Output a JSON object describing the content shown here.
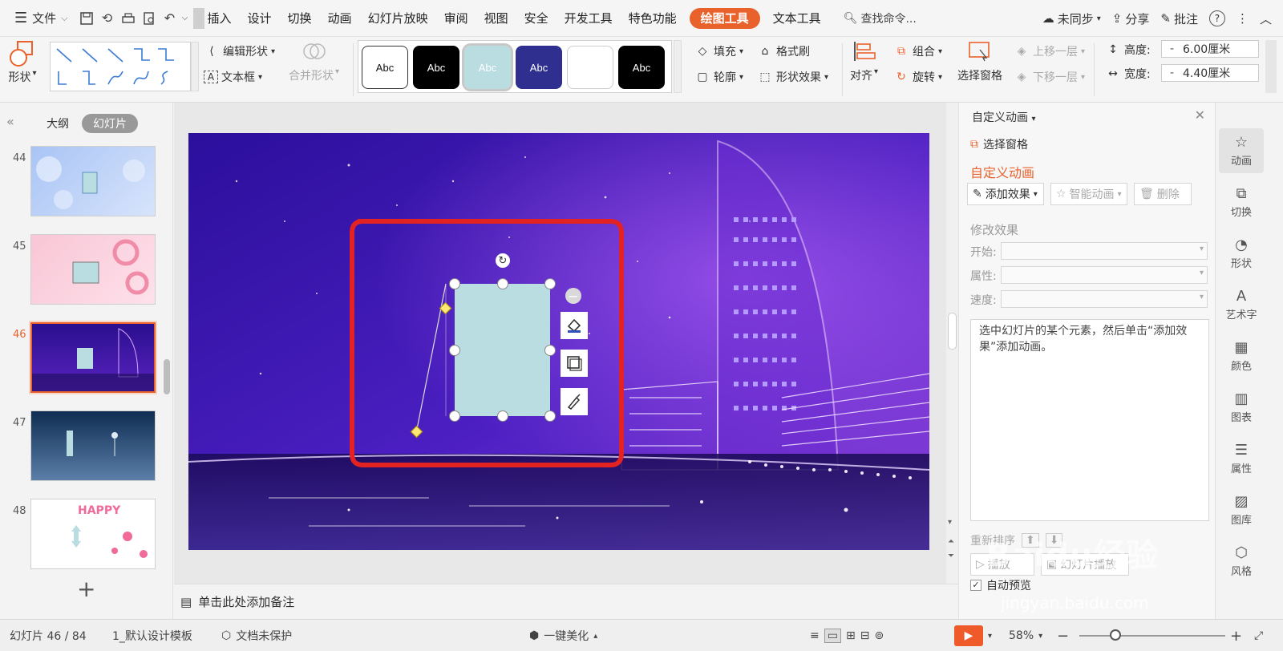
{
  "menubar": {
    "file_label": "文件",
    "tabs": [
      "插入",
      "设计",
      "切换",
      "动画",
      "幻灯片放映",
      "审阅",
      "视图",
      "安全",
      "开发工具",
      "特色功能",
      "绘图工具",
      "文本工具"
    ],
    "active_tab": "绘图工具",
    "search_label": "查找命令...",
    "sync_label": "未同步",
    "share_label": "分享",
    "comment_label": "批注",
    "help_icon": "?"
  },
  "ribbon": {
    "shape_label": "形状",
    "edit_shape_label": "编辑形状",
    "textbox_label": "文本框",
    "merge_shape_label": "合并形状",
    "style_swatches": [
      "Abc",
      "Abc",
      "Abc",
      "Abc",
      "",
      "Abc"
    ],
    "fill_label": "填充",
    "format_painter_label": "格式刷",
    "outline_label": "轮廓",
    "shape_effect_label": "形状效果",
    "align_label": "对齐",
    "group_label": "组合",
    "rotate_label": "旋转",
    "select_pane_label": "选择窗格",
    "bring_forward_label": "上移一层",
    "send_backward_label": "下移一层",
    "height_label": "高度:",
    "height_value": "6.00厘米",
    "width_label": "宽度:",
    "width_value": "4.40厘米",
    "minus": "-"
  },
  "leftpanel": {
    "tab_outline": "大纲",
    "tab_slides": "幻灯片",
    "slides": [
      {
        "num": "44"
      },
      {
        "num": "45"
      },
      {
        "num": "46"
      },
      {
        "num": "47"
      },
      {
        "num": "48",
        "text": "HAPPY"
      }
    ],
    "add_symbol": "+"
  },
  "notes": {
    "placeholder": "单击此处添加备注"
  },
  "taskpane": {
    "title": "自定义动画",
    "select_pane": "选择窗格",
    "heading": "自定义动画",
    "add_effect": "添加效果",
    "smart_anim": "智能动画",
    "delete": "删除",
    "modify_heading": "修改效果",
    "start_label": "开始:",
    "property_label": "属性:",
    "speed_label": "速度:",
    "hint": "选中幻灯片的某个元素，然后单击“添加效果”添加动画。",
    "reorder_label": "重新排序",
    "play_label": "播放",
    "show_label": "幻灯片播放",
    "auto_preview": "自动预览"
  },
  "sidebar": {
    "items": [
      "动画",
      "切换",
      "形状",
      "艺术字",
      "颜色",
      "图表",
      "属性",
      "图库",
      "风格"
    ]
  },
  "statusbar": {
    "slide_info": "幻灯片 46 / 84",
    "template": "1_默认设计模板",
    "protect": "文档未保护",
    "beautify": "一键美化",
    "zoom": "58%"
  },
  "watermark": {
    "text": "Baidu经验",
    "url": "jingyan.baidu.com"
  },
  "colors": {
    "accent": "#e9622c",
    "shape_fill": "#b9dde0",
    "highlight_box": "#e32222"
  }
}
